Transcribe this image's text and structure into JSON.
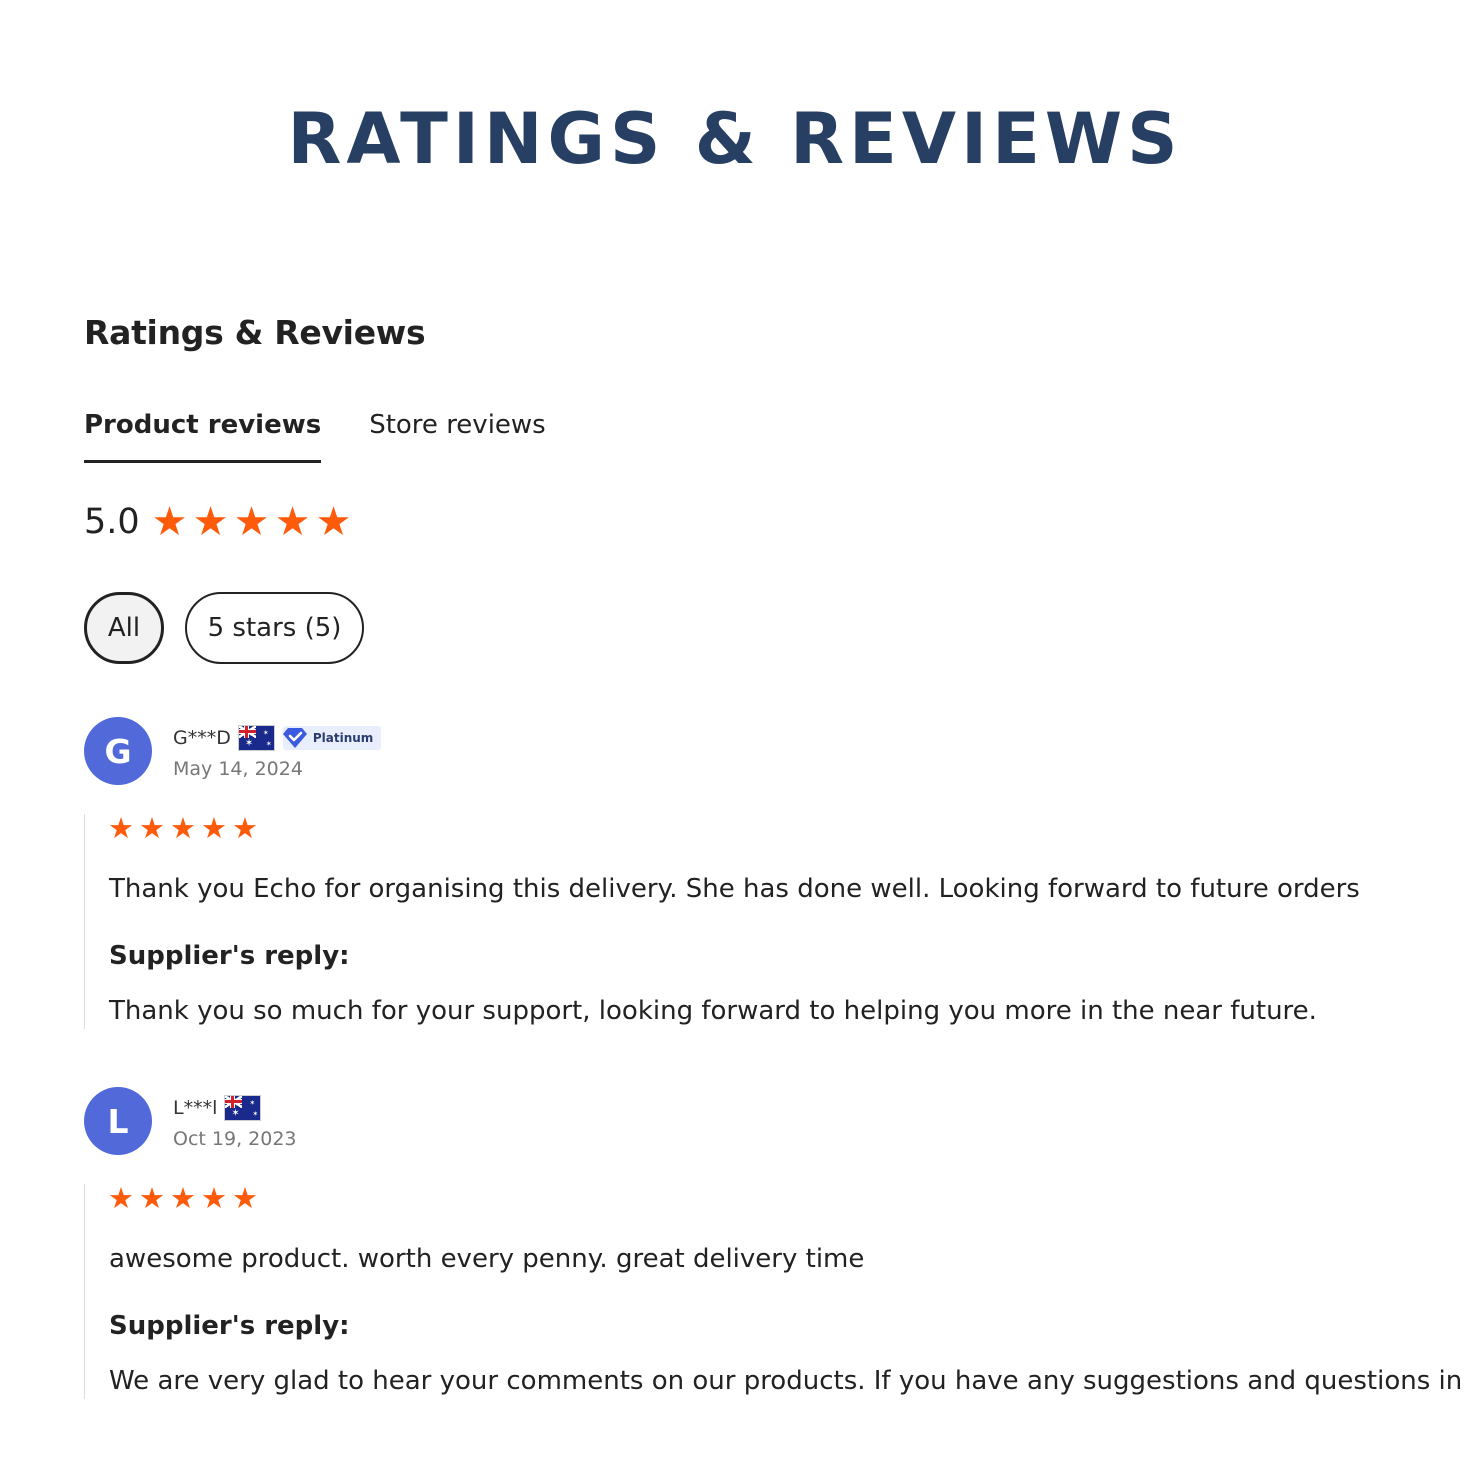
{
  "banner": {
    "title": "RATINGS & REVIEWS"
  },
  "section": {
    "title": "Ratings & Reviews"
  },
  "tabs": [
    {
      "label": "Product reviews",
      "active": true
    },
    {
      "label": "Store reviews",
      "active": false
    }
  ],
  "summary": {
    "score": "5.0",
    "stars": 5,
    "star_color": "#fd5a0a"
  },
  "filters": [
    {
      "label": "All",
      "active": true
    },
    {
      "label": "5 stars (5)",
      "active": false
    }
  ],
  "reviews": [
    {
      "initial": "G",
      "name": "G***D",
      "flag_icon": "australia-flag-icon",
      "badge": "Platinum",
      "date": "May 14, 2024",
      "rating": 5,
      "text": "Thank you Echo for organising this delivery. She has done well. Looking forward to future orders",
      "reply_title": "Supplier's reply:",
      "reply": "Thank you so much for your support, looking forward to helping you more in the near future."
    },
    {
      "initial": "L",
      "name": "L***l",
      "flag_icon": "australia-flag-icon",
      "date": "Oct 19, 2023",
      "rating": 5,
      "text": "awesome product. worth every penny. great delivery time",
      "reply_title": "Supplier's reply:",
      "reply": "We are very glad to hear your comments on our products. If you have any suggestions and questions in"
    }
  ],
  "colors": {
    "title": "#263f63",
    "avatar": "#5169d9",
    "star": "#fd5a0a"
  }
}
